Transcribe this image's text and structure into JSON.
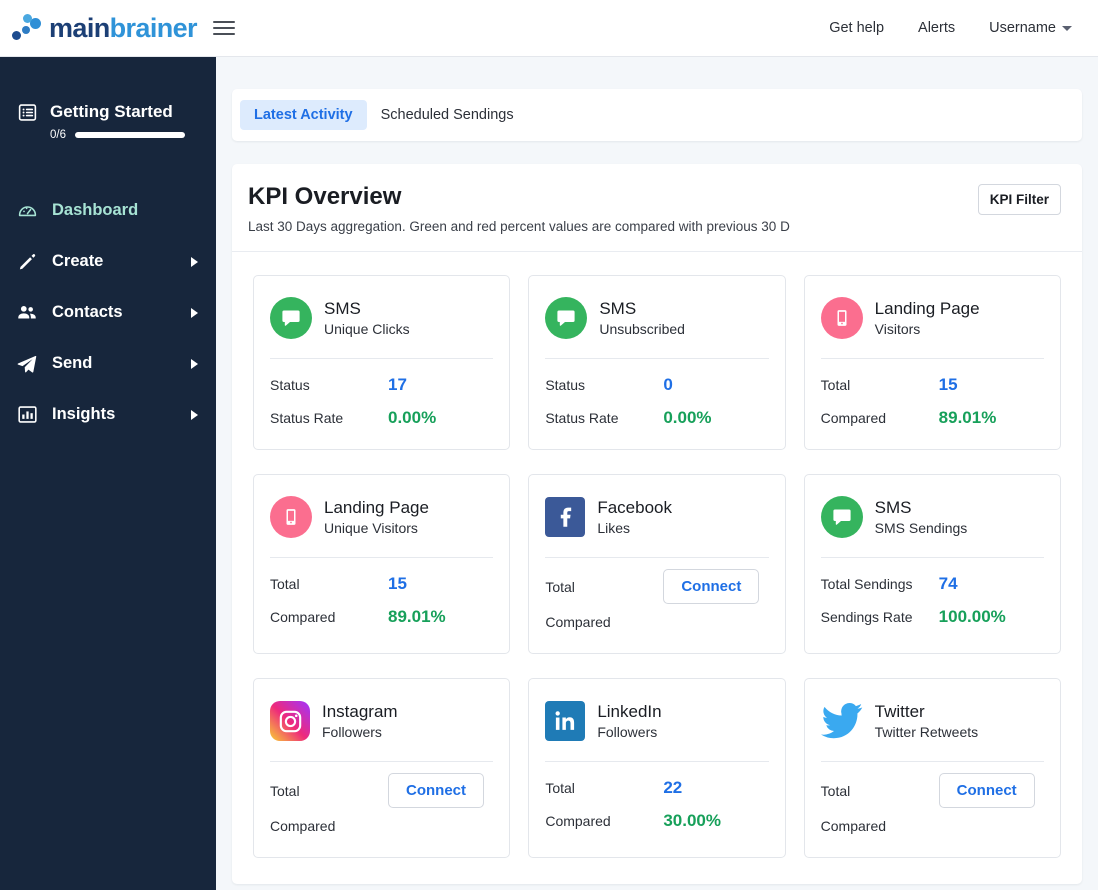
{
  "header": {
    "logo_text_a": "main",
    "logo_text_b": "brainer",
    "menu_icon": "hamburger-icon",
    "links": [
      {
        "label": "Get help"
      },
      {
        "label": "Alerts"
      },
      {
        "label": "Username",
        "has_caret": true
      }
    ]
  },
  "sidebar": {
    "getting_started": {
      "label": "Getting Started",
      "icon": "list-icon",
      "progress_text": "0/6",
      "progress_value": 0,
      "progress_total": 6
    },
    "items": [
      {
        "label": "Dashboard",
        "icon": "speedometer-icon",
        "active": true,
        "has_arrow": false
      },
      {
        "label": "Create",
        "icon": "pencil-icon",
        "active": false,
        "has_arrow": true
      },
      {
        "label": "Contacts",
        "icon": "people-icon",
        "active": false,
        "has_arrow": true
      },
      {
        "label": "Send",
        "icon": "paper-plane-icon",
        "active": false,
        "has_arrow": true
      },
      {
        "label": "Insights",
        "icon": "bar-chart-icon",
        "active": false,
        "has_arrow": true
      }
    ]
  },
  "tabs": [
    {
      "label": "Latest Activity",
      "active": true
    },
    {
      "label": "Scheduled Sendings",
      "active": false
    }
  ],
  "kpi": {
    "title": "KPI Overview",
    "subtitle": "Last 30 Days aggregation. Green and red percent values are compared with previous 30 D",
    "filter_button": "KPI Filter",
    "cards": [
      {
        "brand": "SMS",
        "icon": "sms-bubble-icon",
        "icon_style": "circle-green",
        "metric": "Unique Clicks",
        "row1_label": "Status",
        "row1_value": "17",
        "row1_type": "number",
        "row2_label": "Status Rate",
        "row2_value": "0.00%",
        "row2_type": "percent"
      },
      {
        "brand": "SMS",
        "icon": "sms-bubble-icon",
        "icon_style": "circle-green",
        "metric": "Unsubscribed",
        "row1_label": "Status",
        "row1_value": "0",
        "row1_type": "number",
        "row2_label": "Status Rate",
        "row2_value": "0.00%",
        "row2_type": "percent"
      },
      {
        "brand": "Landing Page",
        "icon": "mobile-phone-icon",
        "icon_style": "circle-pink",
        "metric": "Visitors",
        "row1_label": "Total",
        "row1_value": "15",
        "row1_type": "number",
        "row2_label": "Compared",
        "row2_value": "89.01%",
        "row2_type": "percent"
      },
      {
        "brand": "Landing Page",
        "icon": "mobile-phone-icon",
        "icon_style": "circle-pink",
        "metric": "Unique Visitors",
        "row1_label": "Total",
        "row1_value": "15",
        "row1_type": "number",
        "row2_label": "Compared",
        "row2_value": "89.01%",
        "row2_type": "percent"
      },
      {
        "brand": "Facebook",
        "icon": "facebook-icon",
        "icon_style": "square-facebook",
        "metric": "Likes",
        "row1_label": "Total",
        "row1_value": "Connect",
        "row1_type": "connect",
        "row2_label": "Compared",
        "row2_value": "",
        "row2_type": "empty"
      },
      {
        "brand": "SMS",
        "icon": "sms-bubble-icon",
        "icon_style": "circle-green",
        "metric": "SMS Sendings",
        "row1_label": "Total Sendings",
        "row1_value": "74",
        "row1_type": "number",
        "row2_label": "Sendings Rate",
        "row2_value": "100.00%",
        "row2_type": "percent"
      },
      {
        "brand": "Instagram",
        "icon": "instagram-icon",
        "icon_style": "square-instagram",
        "metric": "Followers",
        "row1_label": "Total",
        "row1_value": "Connect",
        "row1_type": "connect",
        "row2_label": "Compared",
        "row2_value": "",
        "row2_type": "empty"
      },
      {
        "brand": "LinkedIn",
        "icon": "linkedin-icon",
        "icon_style": "square-linkedin",
        "metric": "Followers",
        "row1_label": "Total",
        "row1_value": "22",
        "row1_type": "number",
        "row2_label": "Compared",
        "row2_value": "30.00%",
        "row2_type": "percent"
      },
      {
        "brand": "Twitter",
        "icon": "twitter-bird-icon",
        "icon_style": "plain-twitter",
        "metric": "Twitter Retweets",
        "row1_label": "Total",
        "row1_value": "Connect",
        "row1_type": "connect",
        "row2_label": "Compared",
        "row2_value": "",
        "row2_type": "empty"
      }
    ]
  },
  "colors": {
    "sidebar_bg": "#17263c",
    "accent_blue": "#1f6fe5",
    "positive_green": "#17a05a",
    "active_nav": "#a7e3d4",
    "page_bg": "#f4f7fa",
    "sms_green": "#35b45e",
    "landing_pink": "#fb6e8f",
    "facebook_blue": "#3b5998",
    "linkedin_blue": "#1f7bb6",
    "twitter_blue": "#3aa9f0"
  }
}
